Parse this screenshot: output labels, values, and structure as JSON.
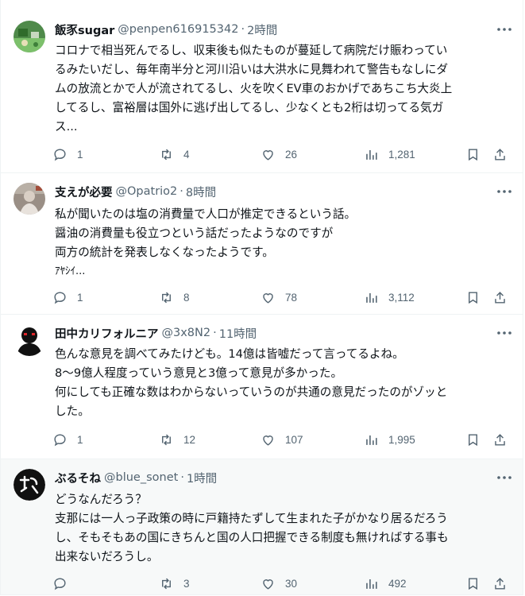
{
  "tweets": [
    {
      "name": "飯豕sugar",
      "handle": "@penpen616915342",
      "time": "2時間",
      "lines": [
        "コロナで相当死んでるし、収束後も似たものが蔓延して病院だけ賑わってい",
        "るみたいだし、毎年南半分と河川沿いは大洪水に見舞われて警告もなしにダ",
        "ムの放流とかで人が流されてるし、火を吹くEV車のおかげであちこち大炎上",
        "してるし、富裕層は国外に逃げ出してるし、少なくとも2桁は切ってる気ガ",
        "ス..."
      ],
      "replies": "1",
      "retweets": "4",
      "likes": "26",
      "views": "1,281"
    },
    {
      "name": "支えが必要",
      "handle": "@Opatrio2",
      "time": "8時間",
      "lines": [
        "私が聞いたのは塩の消費量で人口が推定できるという話。",
        "醤油の消費量も役立つという話だったようなのですが",
        "両方の統計を発表しなくなったようです。",
        "ｱﾔｼｲ..."
      ],
      "replies": "1",
      "retweets": "8",
      "likes": "78",
      "views": "3,112"
    },
    {
      "name": "田中カリフォルニア",
      "handle": "@3x8N2",
      "time": "11時間",
      "lines": [
        "色んな意見を調べてみたけども。14億は皆嘘だって言ってるよね。",
        "8～9億人程度っていう意見と3億って意見が多かった。",
        "何にしても正確な数はわからないっていうのが共通の意見だったのがゾッと",
        "した。"
      ],
      "replies": "1",
      "retweets": "12",
      "likes": "107",
      "views": "1,995"
    },
    {
      "name": "ぶるそね",
      "handle": "@blue_sonet",
      "time": "1時間",
      "lines": [
        "どうなんだろう？",
        "支那には一人っ子政策の時に戸籍持たずして生まれた子がかなり居るだろう",
        "し、そもそもあの国にきちんと国の人口把握できる制度も無ければする事も",
        "出来ないだろうし。"
      ],
      "replies": "",
      "retweets": "3",
      "likes": "30",
      "views": "492"
    }
  ],
  "dot": "·",
  "colors": {
    "text": "#0f1419",
    "muted": "#536471",
    "border": "#eff3f4",
    "hover_bg": "#f7f9f9"
  },
  "icons": [
    "reply-icon",
    "retweet-icon",
    "like-icon",
    "views-icon",
    "bookmark-icon",
    "share-icon",
    "more-icon"
  ]
}
